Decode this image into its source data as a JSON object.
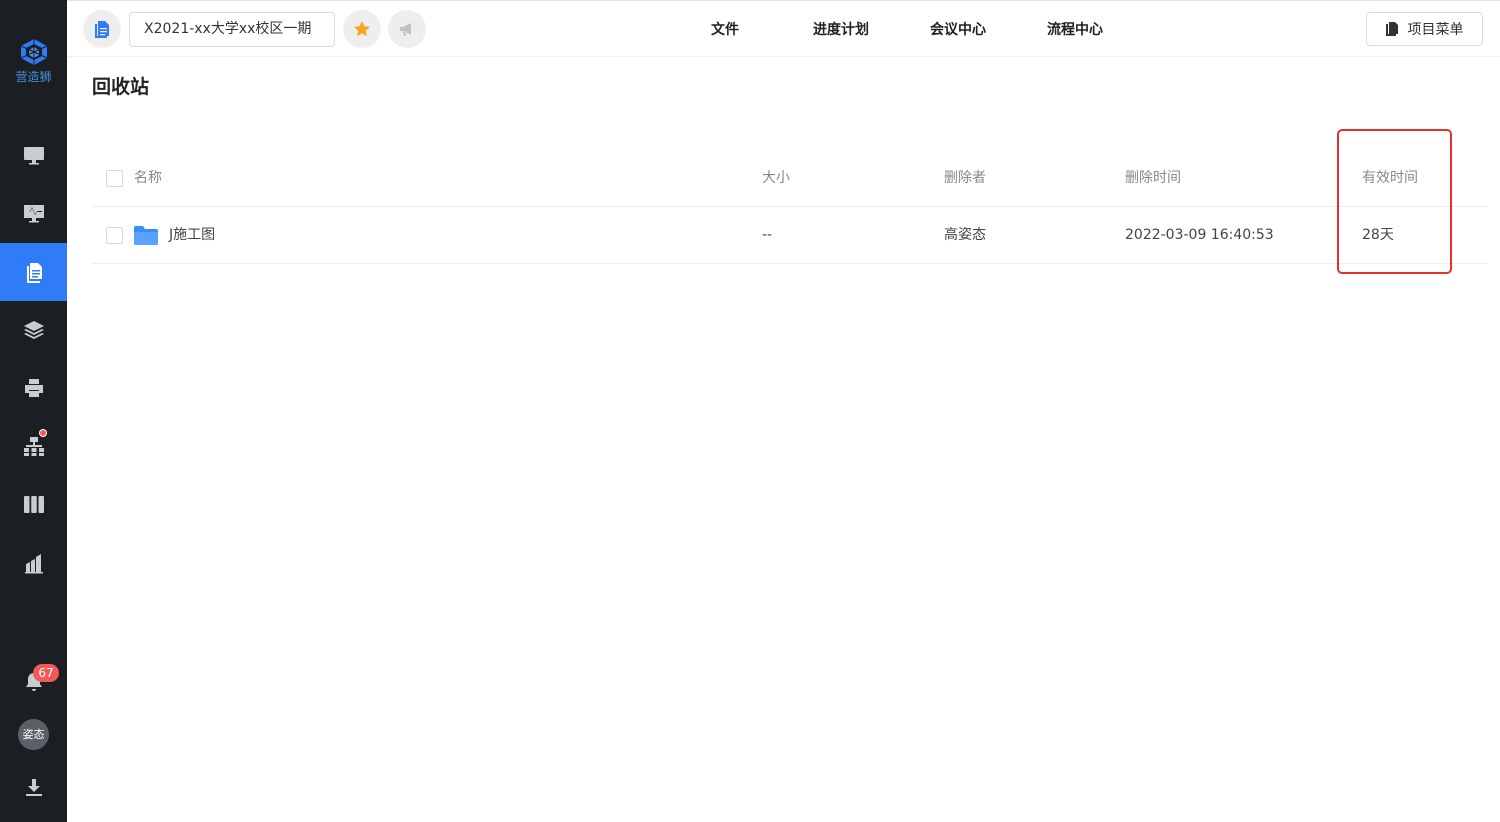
{
  "sidebar": {
    "logo_text": "营造狮",
    "nav": [
      {
        "icon": "monitor-icon"
      },
      {
        "icon": "pulse-monitor-icon"
      },
      {
        "icon": "document-icon",
        "active": true
      },
      {
        "icon": "layers-icon"
      },
      {
        "icon": "printer-icon"
      },
      {
        "icon": "org-chart-icon",
        "has_dot": true
      },
      {
        "icon": "columns-icon"
      },
      {
        "icon": "building-chart-icon"
      }
    ],
    "notification_count": "67",
    "avatar_text": "姿态",
    "download_icon": "download-icon"
  },
  "topbar": {
    "project_name": "X2021-xx大学xx校区一期",
    "tabs": [
      "文件",
      "进度计划",
      "会议中心",
      "流程中心"
    ],
    "menu_label": "项目菜单",
    "favorite_icon": "star-icon",
    "announce_icon": "megaphone-icon"
  },
  "page": {
    "title": "回收站",
    "columns": {
      "name": "名称",
      "size": "大小",
      "deleter": "删除者",
      "deleted_time": "删除时间",
      "valid_time": "有效时间"
    },
    "rows": [
      {
        "name": "J施工图",
        "size": "--",
        "deleter": "高姿态",
        "deleted_time": "2022-03-09 16:40:53",
        "valid_time": "28天",
        "type_icon": "folder-icon"
      }
    ]
  },
  "colors": {
    "sidebar_bg": "#1b1e23",
    "accent": "#2f7cf6",
    "highlight_box": "#e2322b",
    "star": "#f5a623",
    "badge": "#f25a5a"
  }
}
